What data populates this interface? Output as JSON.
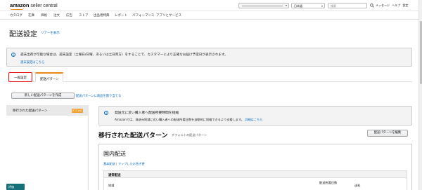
{
  "header": {
    "logo_main": "amazon",
    "logo_sub": "seller central",
    "language": "日本語",
    "search_placeholder": "検索",
    "links": [
      "メッセージ",
      "ヘルプ",
      "設定"
    ]
  },
  "nav": {
    "items": [
      "カタログ",
      "在庫",
      "価格",
      "注文",
      "広告",
      "ストア",
      "出品者特典",
      "レポート",
      "パフォーマンス",
      "アプリとサービス"
    ]
  },
  "page": {
    "title": "配送設定",
    "learn_more": "リアーを表示"
  },
  "info_banner": {
    "text": "週末出荷が可能な場合は、週末設定（土曜日/日曜、あるいは土日両方）をすることで、カスタマーにより正確なお届け予定日が表示されます。",
    "link": "週末設定はこちら"
  },
  "tabs": [
    {
      "label": "一般設定"
    },
    {
      "label": "配送パターン"
    }
  ],
  "actions": {
    "create_button": "新しい配送パターンを作成",
    "assign_link": "配送パターンに商品を割り当てる"
  },
  "sidebar": {
    "items": [
      {
        "label": "移行された配送パターン",
        "badge": "デフォルト"
      }
    ]
  },
  "notice": {
    "title": "発送元に近い購入者へ配送所要時間を短縮",
    "body": "Amazonでは、発送元地域に近い購入者への配送所要日数を自動的に短縮できるよう支援します。",
    "link": "詳細はこちら"
  },
  "template": {
    "title": "移行された配送パターン",
    "subtitle": "デフォルトの配送パターン",
    "edit_button": "配送パターンを編集"
  },
  "domestic": {
    "title": "国内配送",
    "link1": "基本配送",
    "link2": "アップしたお急ぎ便",
    "section_title": "通常配送",
    "col_region": "地域",
    "col_days": "配送所要日数",
    "col_fee": "送料"
  },
  "feedback": {
    "label": "評価"
  }
}
